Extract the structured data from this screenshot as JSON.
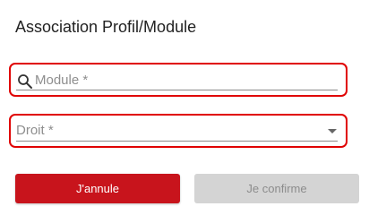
{
  "dialog": {
    "title": "Association Profil/Module"
  },
  "fields": {
    "module": {
      "placeholder": "Module *",
      "value": "",
      "icon": "search-icon"
    },
    "droit": {
      "placeholder": "Droit *",
      "selected": "",
      "icon": "chevron-down-icon"
    }
  },
  "actions": {
    "cancel_label": "J'annule",
    "confirm_label": "Je confirme"
  },
  "colors": {
    "highlight_border": "#e00000",
    "primary": "#c8141c",
    "disabled": "#d4d4d4"
  }
}
